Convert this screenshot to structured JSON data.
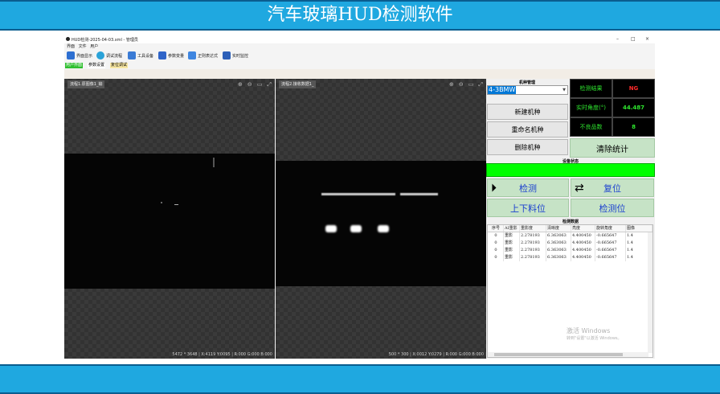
{
  "banner": {
    "title": "汽车玻璃HUD检测软件"
  },
  "window": {
    "title": "HUD检测-2025-04-03.xml - 管理员",
    "controls": [
      "–",
      "□",
      "×"
    ]
  },
  "menu": [
    "界面",
    "文件",
    "用户"
  ],
  "toolbar": [
    {
      "label": "界面显示",
      "icon": "monitor-icon",
      "color": "#2d6fd1"
    },
    {
      "label": "调试流程",
      "icon": "refresh-icon",
      "color": "#2aa2d8"
    },
    {
      "label": "工具设备",
      "icon": "tools-icon",
      "color": "#3a7bd5"
    },
    {
      "label": "参数变量",
      "icon": "chart-icon",
      "color": "#2f64c8"
    },
    {
      "label": "正则表达式",
      "icon": "grid-icon",
      "color": "#3f86e0"
    },
    {
      "label": "实时监控",
      "icon": "monitor-live-icon",
      "color": "#2c5fb8"
    }
  ],
  "subtabs": [
    {
      "label": "用户界面",
      "bg": "#2fbf2f",
      "color": "#ffffff"
    },
    {
      "label": "参数设置",
      "bg": "#ffffff",
      "color": "#000000"
    },
    {
      "label": "复位调试",
      "bg": "#f7e7a3",
      "color": "#000000"
    }
  ],
  "viewers": [
    {
      "tab": "流程1.原图像1_输",
      "status": "5472 * 3648  |  X:4119  Y:0095  |  R:000  G:000  B:000"
    },
    {
      "tab": "流程2.接收数据1_",
      "status": "500 * 300  |  X:0012  Y:0279  |  R:000  G:000  B:000"
    }
  ],
  "model_panel": {
    "title": "机种管理",
    "selected_model": "4-3BMW",
    "buttons": [
      "新建机种",
      "重命名机种",
      "删除机种"
    ]
  },
  "results": {
    "detect_label": "检测结果",
    "detect_value": "NG",
    "angle_label": "实时角度(°)",
    "angle_value": "44.487",
    "bad_label": "不良品数",
    "bad_value": "8",
    "clear_button": "清除统计"
  },
  "device_status": {
    "title": "设备状态",
    "color": "#00ff00"
  },
  "actions": {
    "detect": "检测",
    "reset": "复位",
    "load": "上下料位",
    "detect_pos": "检测位"
  },
  "data_table": {
    "title": "检测数据",
    "columns": [
      "序号",
      "AI重影",
      "重影度",
      "清晰度",
      "亮度",
      "旋转角度",
      "图像"
    ],
    "rows": [
      [
        "0",
        "重影",
        "2.278193",
        "6.363063",
        "4.400450",
        "-0.665647",
        "1.4"
      ],
      [
        "0",
        "重影",
        "2.278193",
        "6.363063",
        "4.400450",
        "-0.665647",
        "1.4"
      ],
      [
        "0",
        "重影",
        "2.278193",
        "6.363063",
        "4.400450",
        "-0.665647",
        "1.4"
      ],
      [
        "0",
        "重影",
        "2.278193",
        "6.363063",
        "4.400450",
        "-0.665647",
        "1.4"
      ]
    ]
  },
  "watermark": {
    "line1": "激活 Windows",
    "line2": "转到\"设置\"以激活 Windows。"
  }
}
